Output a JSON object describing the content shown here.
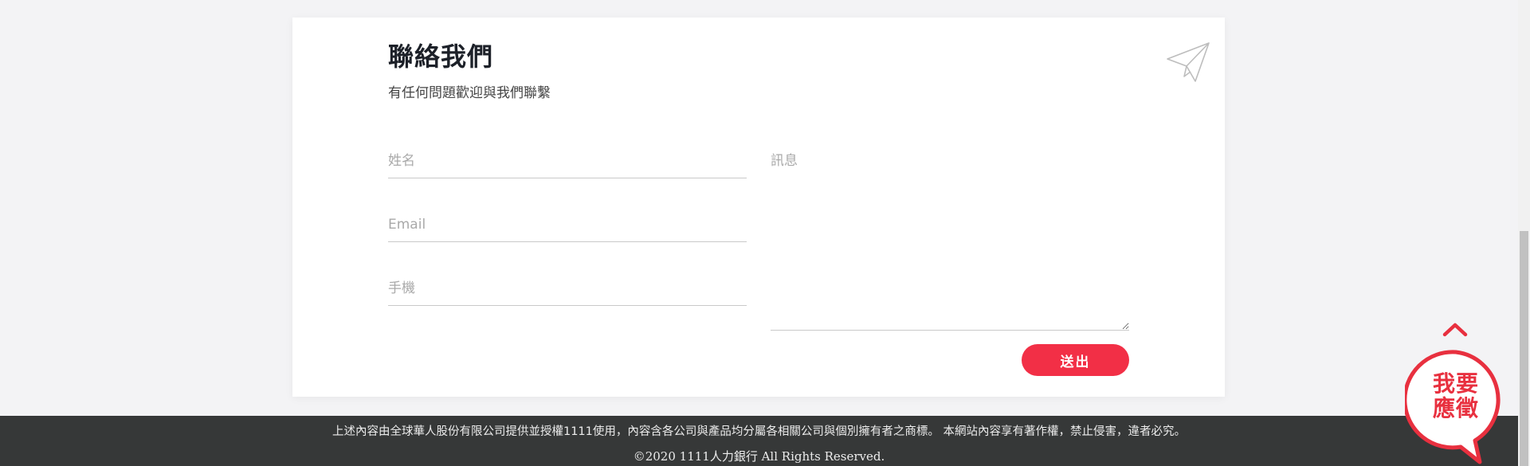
{
  "contact": {
    "title": "聯絡我們",
    "subtitle": "有任何問題歡迎與我們聯繫",
    "name_placeholder": "姓名",
    "email_placeholder": "Email",
    "phone_placeholder": "手機",
    "message_placeholder": "訊息",
    "submit_label": "送出"
  },
  "footer": {
    "notice": "上述內容由全球華人股份有限公司提供並授權1111使用，內容含各公司與產品均分屬各相關公司與個別擁有者之商標。 本網站內容享有著作權，禁止侵害，違者必究。",
    "copyright": "©2020 1111人力銀行 All Rights Reserved."
  },
  "floating": {
    "apply_line1": "我要",
    "apply_line2": "應徵"
  },
  "icons": {
    "paper_plane": "paper-plane-icon",
    "scroll_top": "chevron-up-icon"
  },
  "colors": {
    "accent": "#f22f46",
    "footer_bg": "#363838",
    "page_bg": "#f3f3f5"
  }
}
